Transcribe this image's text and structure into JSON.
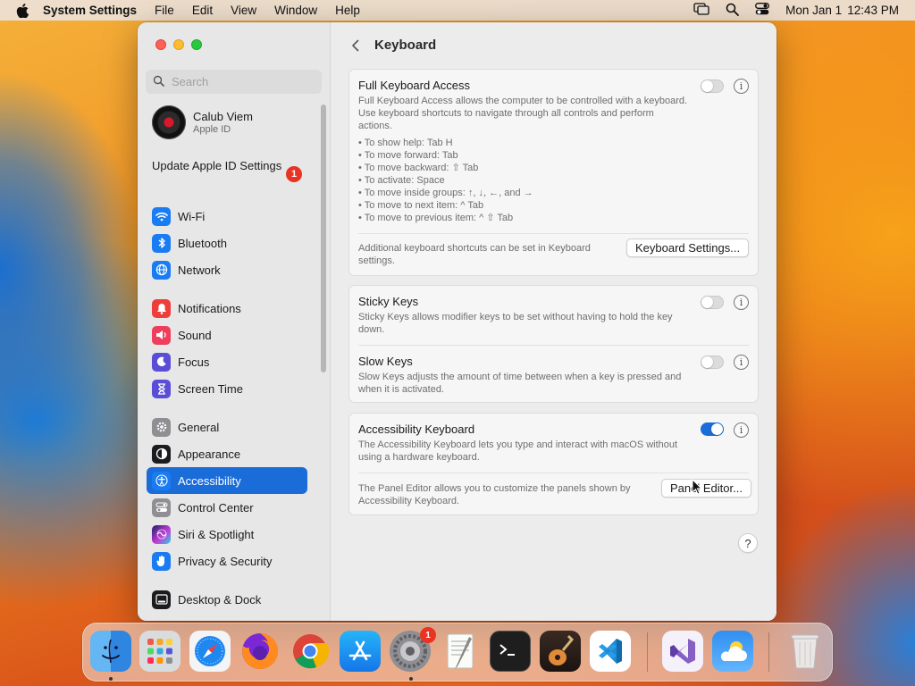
{
  "menubar": {
    "app_name": "System Settings",
    "menus": [
      "File",
      "Edit",
      "View",
      "Window",
      "Help"
    ],
    "clock_date": "Mon Jan 1",
    "clock_time": "12:43 PM",
    "icons": [
      "apple-icon",
      "screen-mirroring-icon",
      "spotlight-search-icon",
      "control-center-icon"
    ]
  },
  "sidebar": {
    "search_placeholder": "Search",
    "account": {
      "name": "Calub Viem",
      "subtitle": "Apple ID"
    },
    "update": {
      "label": "Update Apple ID Settings",
      "badge": "1"
    },
    "items": [
      {
        "label": "Wi-Fi",
        "icon": "wifi-icon",
        "color": "#1a7cf2"
      },
      {
        "label": "Bluetooth",
        "icon": "bluetooth-icon",
        "color": "#1a7cf2"
      },
      {
        "label": "Network",
        "icon": "globe-icon",
        "color": "#1a7cf2"
      },
      {
        "label": "Notifications",
        "icon": "bell-icon",
        "color": "#ee3e3a"
      },
      {
        "label": "Sound",
        "icon": "speaker-icon",
        "color": "#ee3e5c"
      },
      {
        "label": "Focus",
        "icon": "moon-icon",
        "color": "#5b4ed6"
      },
      {
        "label": "Screen Time",
        "icon": "hourglass-icon",
        "color": "#5b4ed6"
      },
      {
        "label": "General",
        "icon": "gear-icon",
        "color": "#8e8e93"
      },
      {
        "label": "Appearance",
        "icon": "appearance-icon",
        "color": "#1c1c1e"
      },
      {
        "label": "Accessibility",
        "icon": "accessibility-icon",
        "color": "#1a7cf2",
        "selected": true
      },
      {
        "label": "Control Center",
        "icon": "control-center-icon",
        "color": "#8e8e93"
      },
      {
        "label": "Siri & Spotlight",
        "icon": "siri-icon",
        "color": "#7a3fc4"
      },
      {
        "label": "Privacy & Security",
        "icon": "hand-icon",
        "color": "#1a7cf2"
      },
      {
        "label": "Desktop & Dock",
        "icon": "dock-icon",
        "color": "#1c1c1e"
      }
    ]
  },
  "main": {
    "title": "Keyboard",
    "full_keyboard_access": {
      "title": "Full Keyboard Access",
      "description": "Full Keyboard Access allows the computer to be controlled with a keyboard. Use keyboard shortcuts to navigate through all controls and perform actions.",
      "bullets": [
        "• To show help: Tab H",
        "• To move forward: Tab",
        "• To move backward: ⇧ Tab",
        "• To activate: Space",
        "• To move inside groups: ↑, ↓, ←, and →",
        "• To move to next item: ^ Tab",
        "• To move to previous item: ^ ⇧ Tab"
      ],
      "enabled": false,
      "footer": "Additional keyboard shortcuts can be set in Keyboard settings.",
      "button": "Keyboard Settings..."
    },
    "sticky_keys": {
      "title": "Sticky Keys",
      "description": "Sticky Keys allows modifier keys to be set without having to hold the key down.",
      "enabled": false
    },
    "slow_keys": {
      "title": "Slow Keys",
      "description": "Slow Keys adjusts the amount of time between when a key is pressed and when it is activated.",
      "enabled": false
    },
    "accessibility_keyboard": {
      "title": "Accessibility Keyboard",
      "description": "The Accessibility Keyboard lets you type and interact with macOS without using a hardware keyboard.",
      "enabled": true,
      "footer": "The Panel Editor allows you to customize the panels shown by Accessibility Keyboard.",
      "button": "Panel Editor..."
    },
    "help": "?"
  },
  "dock": {
    "apps": [
      {
        "name": "Finder",
        "icon": "finder-icon",
        "running": true
      },
      {
        "name": "Launchpad",
        "icon": "launchpad-icon"
      },
      {
        "name": "Safari",
        "icon": "safari-icon"
      },
      {
        "name": "Firefox",
        "icon": "firefox-icon"
      },
      {
        "name": "Chrome",
        "icon": "chrome-icon"
      },
      {
        "name": "App Store",
        "icon": "app-store-icon"
      },
      {
        "name": "System Settings",
        "icon": "system-settings-icon",
        "running": true,
        "badge": "1"
      },
      {
        "name": "TextEdit",
        "icon": "textedit-icon"
      },
      {
        "name": "Terminal",
        "icon": "terminal-icon"
      },
      {
        "name": "Instruments",
        "icon": "guitar-icon"
      },
      {
        "name": "Visual Studio Code",
        "icon": "vscode-icon"
      },
      {
        "name": "Visual Studio",
        "icon": "visual-studio-icon"
      },
      {
        "name": "Weather",
        "icon": "weather-icon"
      },
      {
        "name": "Trash",
        "icon": "trash-icon"
      }
    ]
  }
}
